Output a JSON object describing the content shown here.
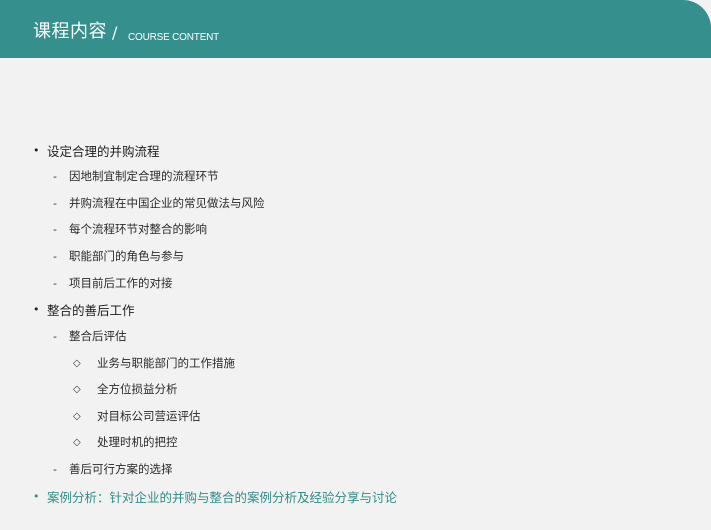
{
  "header": {
    "title": "课程内容",
    "separator": "/",
    "subtitle": "COURSE CONTENT"
  },
  "colors": {
    "header_bg": "#358f8c",
    "page_bg": "#f2f2f2",
    "accent_text": "#2f8d89"
  },
  "outline": {
    "items": [
      {
        "marker": "•",
        "text": "设定合理的并购流程"
      },
      {
        "marker": "-",
        "text": "因地制宜制定合理的流程环节"
      },
      {
        "marker": "-",
        "text": "并购流程在中国企业的常见做法与风险"
      },
      {
        "marker": "-",
        "text": "每个流程环节对整合的影响"
      },
      {
        "marker": "-",
        "text": "职能部门的角色与参与"
      },
      {
        "marker": "-",
        "text": "项目前后工作的对接"
      },
      {
        "marker": "•",
        "text": "整合的善后工作"
      },
      {
        "marker": "-",
        "text": "整合后评估"
      },
      {
        "marker": "◇",
        "text": "业务与职能部门的工作措施"
      },
      {
        "marker": "◇",
        "text": "全方位损益分析"
      },
      {
        "marker": "◇",
        "text": "对目标公司营运评估"
      },
      {
        "marker": "◇",
        "text": "处理时机的把控"
      },
      {
        "marker": "-",
        "text": "善后可行方案的选择"
      },
      {
        "marker": "•",
        "text": "案例分析：针对企业的并购与整合的案例分析及经验分享与讨论"
      }
    ]
  }
}
